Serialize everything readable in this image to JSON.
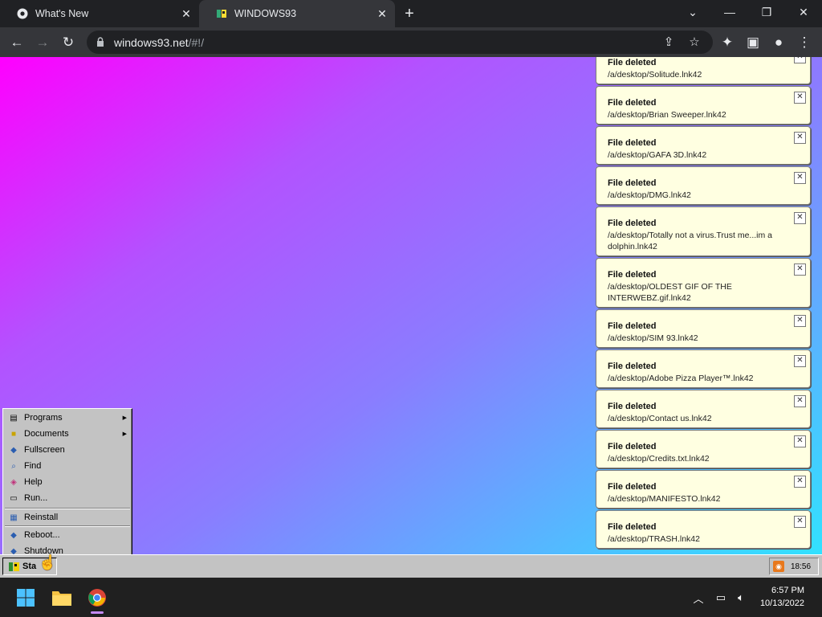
{
  "browser": {
    "tabs": [
      {
        "title": "What's New",
        "icon": "chrome-icon"
      },
      {
        "title": "WINDOWS93",
        "icon": "windows93-icon"
      }
    ],
    "url_host": "windows93.net",
    "url_path": "/#!/"
  },
  "notifications": [
    {
      "title": "File deleted",
      "path": "/a/desktop/Solitude.lnk42"
    },
    {
      "title": "File deleted",
      "path": "/a/desktop/Brian Sweeper.lnk42"
    },
    {
      "title": "File deleted",
      "path": "/a/desktop/GAFA 3D.lnk42"
    },
    {
      "title": "File deleted",
      "path": "/a/desktop/DMG.lnk42"
    },
    {
      "title": "File deleted",
      "path": "/a/desktop/Totally not a virus.Trust me...im a dolphin.lnk42"
    },
    {
      "title": "File deleted",
      "path": "/a/desktop/OLDEST GIF OF THE INTERWEBZ.gif.lnk42"
    },
    {
      "title": "File deleted",
      "path": "/a/desktop/SIM 93.lnk42"
    },
    {
      "title": "File deleted",
      "path": "/a/desktop/Adobe Pizza Player™.lnk42"
    },
    {
      "title": "File deleted",
      "path": "/a/desktop/Contact us.lnk42"
    },
    {
      "title": "File deleted",
      "path": "/a/desktop/Credits.txt.lnk42"
    },
    {
      "title": "File deleted",
      "path": "/a/desktop/MANIFESTO.lnk42"
    },
    {
      "title": "File deleted",
      "path": "/a/desktop/TRASH.lnk42"
    }
  ],
  "start_menu": {
    "items": [
      {
        "label": "Programs",
        "icon": "programs-icon",
        "submenu": true
      },
      {
        "label": "Documents",
        "icon": "documents-icon",
        "submenu": true
      },
      {
        "label": "Fullscreen",
        "icon": "fullscreen-icon",
        "submenu": false
      },
      {
        "label": "Find",
        "icon": "find-icon",
        "submenu": false
      },
      {
        "label": "Help",
        "icon": "help-icon",
        "submenu": false
      },
      {
        "label": "Run...",
        "icon": "run-icon",
        "submenu": false
      },
      {
        "label": "Reinstall",
        "icon": "reinstall-icon",
        "submenu": false
      },
      {
        "label": "Reboot...",
        "icon": "reboot-icon",
        "submenu": false
      },
      {
        "label": "Shutdown",
        "icon": "shutdown-icon",
        "submenu": false
      }
    ]
  },
  "w93_taskbar": {
    "start_label": "Sta",
    "clock": "18:56"
  },
  "windows_taskbar": {
    "time": "6:57 PM",
    "date": "10/13/2022"
  }
}
